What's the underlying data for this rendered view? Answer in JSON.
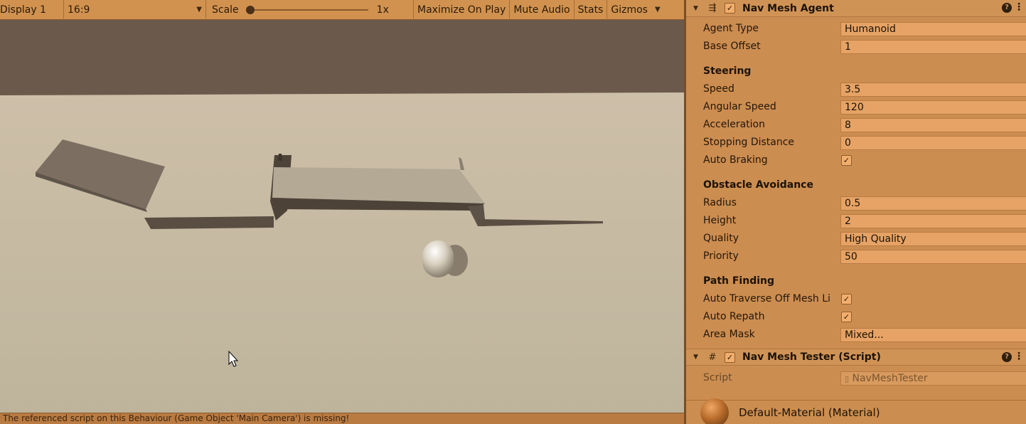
{
  "game_toolbar": {
    "display": "Display 1",
    "aspect": "16:9",
    "scale_label": "Scale",
    "scale_value": "1x",
    "maximize_on_play": "Maximize On Play",
    "mute_audio": "Mute Audio",
    "stats": "Stats",
    "gizmos": "Gizmos"
  },
  "status_bar": {
    "message": "The referenced script on this Behaviour (Game Object 'Main Camera') is missing!"
  },
  "nav_mesh_agent": {
    "title": "Nav Mesh Agent",
    "enabled": true,
    "agent_type": {
      "label": "Agent Type",
      "value": "Humanoid"
    },
    "base_offset": {
      "label": "Base Offset",
      "value": "1"
    },
    "steering": {
      "heading": "Steering",
      "speed": {
        "label": "Speed",
        "value": "3.5"
      },
      "angular_speed": {
        "label": "Angular Speed",
        "value": "120"
      },
      "acceleration": {
        "label": "Acceleration",
        "value": "8"
      },
      "stopping_distance": {
        "label": "Stopping Distance",
        "value": "0"
      },
      "auto_braking": {
        "label": "Auto Braking",
        "checked": true
      }
    },
    "obstacle_avoidance": {
      "heading": "Obstacle Avoidance",
      "radius": {
        "label": "Radius",
        "value": "0.5"
      },
      "height": {
        "label": "Height",
        "value": "2"
      },
      "quality": {
        "label": "Quality",
        "value": "High Quality"
      },
      "priority": {
        "label": "Priority",
        "value": "50"
      }
    },
    "path_finding": {
      "heading": "Path Finding",
      "auto_traverse": {
        "label": "Auto Traverse Off Mesh Li",
        "checked": true
      },
      "auto_repath": {
        "label": "Auto Repath",
        "checked": true
      },
      "area_mask": {
        "label": "Area Mask",
        "value": "Mixed..."
      }
    }
  },
  "nav_mesh_tester": {
    "title": "Nav Mesh Tester (Script)",
    "enabled": true,
    "script": {
      "label": "Script",
      "value": "NavMeshTester"
    }
  },
  "material": {
    "label": "Default-Material (Material)"
  },
  "icons": {
    "check": "✓",
    "help": "?",
    "menu": "⋮",
    "fold": "▼",
    "dropdown": "▼",
    "agent_icon": "⇶",
    "script_icon": "#"
  },
  "colors": {
    "inspector_bg": "#cc8d50",
    "field_bg": "#e6a365",
    "scene_sky": "#6b5a4b",
    "scene_ground": "#c4b9a3"
  }
}
